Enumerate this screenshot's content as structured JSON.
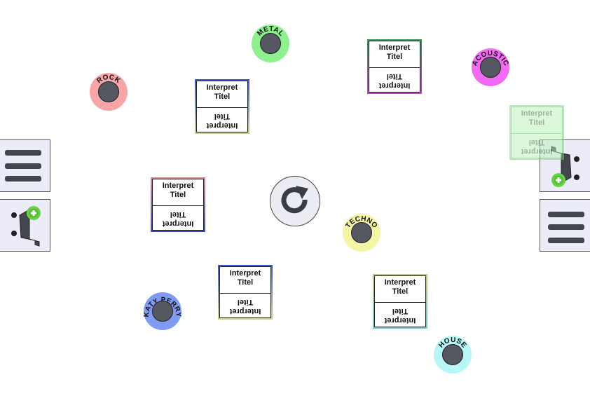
{
  "genres": [
    {
      "id": "rock",
      "label": "ROCK",
      "color": "#f6a6a6"
    },
    {
      "id": "metal",
      "label": "METAL",
      "color": "#8ef08e"
    },
    {
      "id": "acoustic",
      "label": "ACOUSTIC",
      "color": "#f26af2"
    },
    {
      "id": "techno",
      "label": "TECHNO",
      "color": "#f5f5a8"
    },
    {
      "id": "katy-perry",
      "label": "KATY PERRY",
      "color": "#7f9bf2"
    },
    {
      "id": "house",
      "label": "HOUSE",
      "color": "#b7f7f7"
    }
  ],
  "cards": [
    {
      "artist": "Interpret",
      "title": "Titel",
      "frame": "linear-gradient(180deg,#3b57c6,#c7cf8c)"
    },
    {
      "artist": "Interpret",
      "title": "Titel",
      "frame": "linear-gradient(180deg,#2f9e52,#c540c5)"
    },
    {
      "artist": "Interpret",
      "title": "Titel",
      "frame": "linear-gradient(180deg,#d9868e,#3b4fb8)"
    },
    {
      "artist": "Interpret",
      "title": "Titel",
      "frame": "linear-gradient(180deg,#3b57c6,#cfcf88)"
    },
    {
      "artist": "Interpret",
      "title": "Titel",
      "frame": "linear-gradient(180deg,#c9c380,#77c7cf)"
    },
    {
      "artist": "Interpret",
      "title": "Titel",
      "frame": "#7fd07f"
    }
  ],
  "icons": {
    "menu_left": "hamburger-menu-icon",
    "menu_right": "hamburger-menu-icon",
    "add_left": "add-card-icon",
    "add_right": "add-card-icon",
    "reset": "redo-icon"
  }
}
